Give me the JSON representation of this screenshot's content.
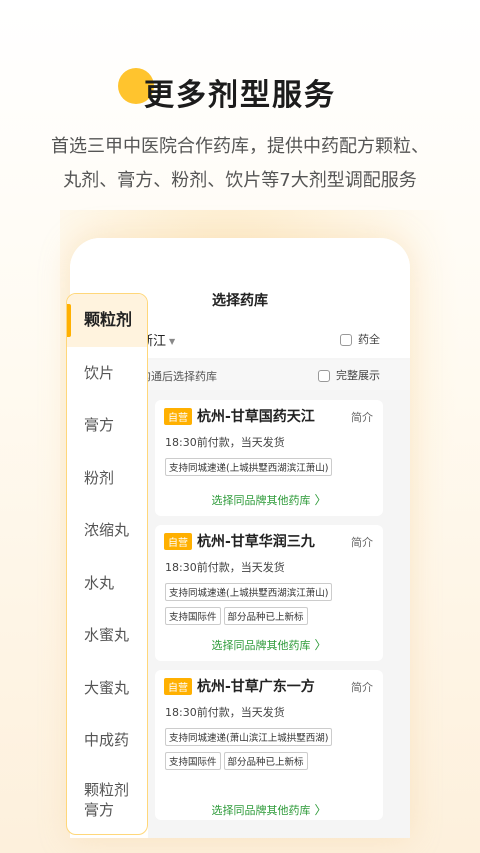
{
  "hero": {
    "title": "更多剂型服务",
    "desc_line1": "首选三甲中医院合作药库，提供中药配方颗粒、",
    "desc_line2": "丸剂、膏方、粉剂、饮片等7大剂型调配服务"
  },
  "screen": {
    "title": "选择药库",
    "region": "浙江",
    "all_label": "药全",
    "hint": "沟通后选择药库",
    "full_display": "完整展示"
  },
  "sidebar": {
    "items": [
      {
        "label": "颗粒剂"
      },
      {
        "label": "饮片"
      },
      {
        "label": "膏方"
      },
      {
        "label": "粉剂"
      },
      {
        "label": "浓缩丸"
      },
      {
        "label": "水丸"
      },
      {
        "label": "水蜜丸"
      },
      {
        "label": "大蜜丸"
      },
      {
        "label": "中成药"
      },
      {
        "label": "颗粒剂\n膏方"
      }
    ]
  },
  "cards": [
    {
      "badge": "自营",
      "name": "杭州-甘草国药天江",
      "intro": "简介",
      "ship": "18:30前付款，当天发货",
      "tags": [
        "支持同城速递(上城拱墅西湖滨江萧山)"
      ],
      "more": "选择同品牌其他药库"
    },
    {
      "badge": "自营",
      "name": "杭州-甘草华润三九",
      "intro": "简介",
      "ship": "18:30前付款，当天发货",
      "tags": [
        "支持同城速递(上城拱墅西湖滨江萧山)",
        "支持国际件",
        "部分品种已上新标"
      ],
      "more": "选择同品牌其他药库"
    },
    {
      "badge": "自营",
      "name": "杭州-甘草广东一方",
      "intro": "简介",
      "ship": "18:30前付款，当天发货",
      "tags": [
        "支持同城速递(萧山滨江上城拱墅西湖)",
        "支持国际件",
        "部分品种已上新标"
      ],
      "more": "选择同品牌其他药库"
    }
  ],
  "colors": {
    "accent": "#ffb000",
    "link": "#2e9b3a",
    "hero_dot": "#ffc42e"
  }
}
